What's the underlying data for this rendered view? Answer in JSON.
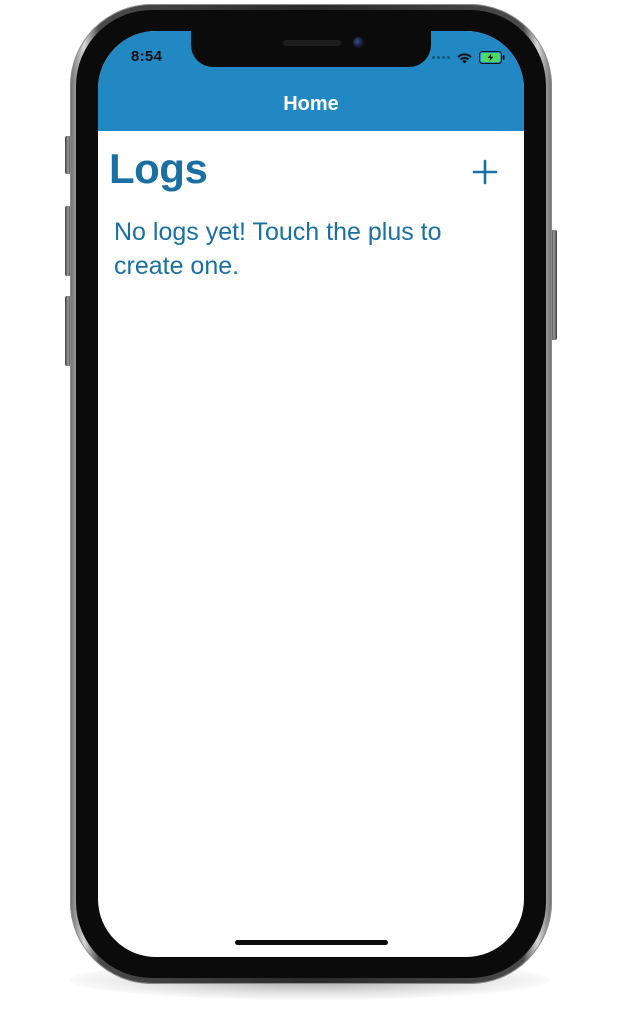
{
  "status_bar": {
    "time": "8:54",
    "icons": [
      "signal-dots-icon",
      "wifi-icon",
      "battery-charging-icon"
    ]
  },
  "nav": {
    "title": "Home"
  },
  "page": {
    "title": "Logs",
    "add_icon": "plus-icon",
    "empty_message": "No logs yet! Touch the plus to create one."
  },
  "colors": {
    "header": "#2288c4",
    "accent_text": "#1a6fa3",
    "battery": "#4cd964"
  }
}
